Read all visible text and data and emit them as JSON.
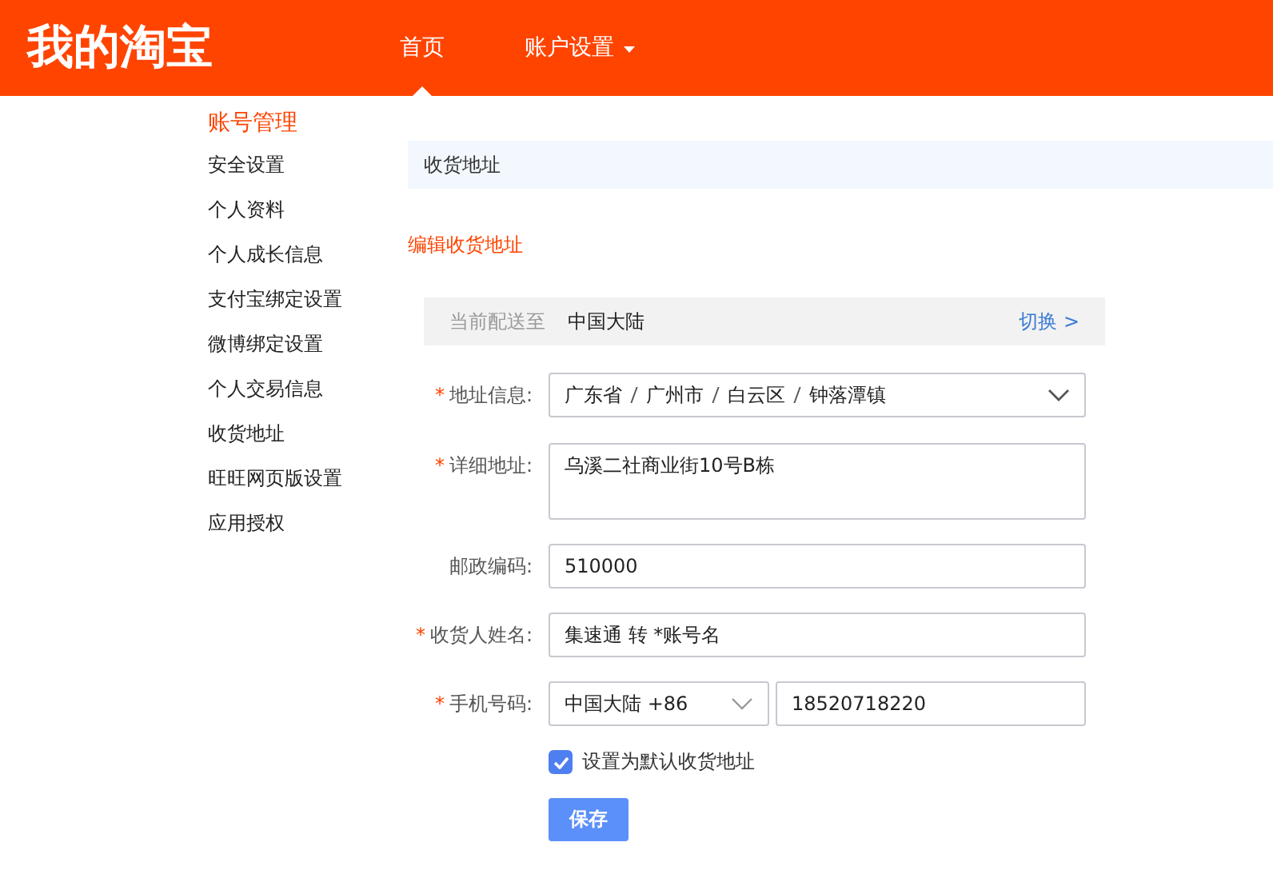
{
  "header": {
    "logo": "我的淘宝",
    "nav": [
      {
        "label": "首页",
        "selected": true,
        "dropdown": false
      },
      {
        "label": "账户设置",
        "selected": false,
        "dropdown": true
      }
    ]
  },
  "sidebar": {
    "title": "账号管理",
    "items": [
      "安全设置",
      "个人资料",
      "个人成长信息",
      "支付宝绑定设置",
      "微博绑定设置",
      "个人交易信息",
      "收货地址",
      "旺旺网页版设置",
      "应用授权"
    ]
  },
  "section_title": "收货地址",
  "subtitle": "编辑收货地址",
  "region_bar": {
    "label": "当前配送至",
    "value": "中国大陆",
    "link": "切换 >"
  },
  "form": [
    {
      "kind": "cascade",
      "label": "地址信息:",
      "required_mark": "*",
      "parts": [
        "广东省",
        "广州市",
        "白云区",
        "钟落潭镇"
      ]
    },
    {
      "kind": "textarea",
      "label": "详细地址:",
      "required_mark": "*",
      "value": "乌溪二社商业街10号B栋"
    },
    {
      "kind": "input",
      "label": "邮政编码:",
      "value": "510000"
    },
    {
      "kind": "input",
      "label": "收货人姓名:",
      "required_mark": "*",
      "value": "集速通 转 *账号名"
    },
    {
      "kind": "phone",
      "label": "手机号码:",
      "required_mark": "*",
      "country": "中国大陆 +86",
      "value": "18520718220"
    }
  ],
  "default_checkbox": {
    "label": "设置为默认收货地址",
    "checked": true
  },
  "save_button": "保存"
}
